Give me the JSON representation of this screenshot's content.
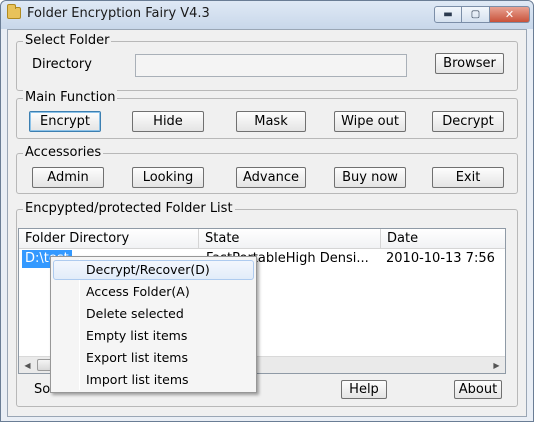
{
  "window": {
    "title": "Folder Encryption Fairy V4.3",
    "controls": {
      "minimize": "▬",
      "maximize": "▢",
      "close": "✕"
    }
  },
  "select_folder": {
    "group_title": "Select Folder",
    "directory_label": "Directory",
    "directory_value": "",
    "browse_button": "Browser"
  },
  "main_function": {
    "group_title": "Main Function",
    "buttons": [
      "Encrypt",
      "Hide",
      "Mask",
      "Wipe out",
      "Decrypt"
    ]
  },
  "accessories": {
    "group_title": "Accessories",
    "buttons": [
      "Admin",
      "Looking",
      "Advance",
      "Buy now",
      "Exit"
    ]
  },
  "folder_list": {
    "group_title": "Encpypted/protected Folder List",
    "columns": [
      "Folder Directory",
      "State",
      "Date"
    ],
    "rows": [
      [
        "D:\\test",
        "FastPortableHigh Densi...",
        "2010-10-13 7:56"
      ]
    ]
  },
  "footer": {
    "left_text": "So",
    "help_button": "Help",
    "about_button": "About"
  },
  "context_menu": {
    "items": [
      "Decrypt/Recover(D)",
      "Access Folder(A)",
      "Delete selected",
      "Empty list items",
      "Export list items",
      "Import list items"
    ],
    "highlighted_index": 0
  },
  "colors": {
    "selection": "#3399ff",
    "window_bg": "#f0f0f0",
    "titlebar": "#c8d7ea"
  }
}
